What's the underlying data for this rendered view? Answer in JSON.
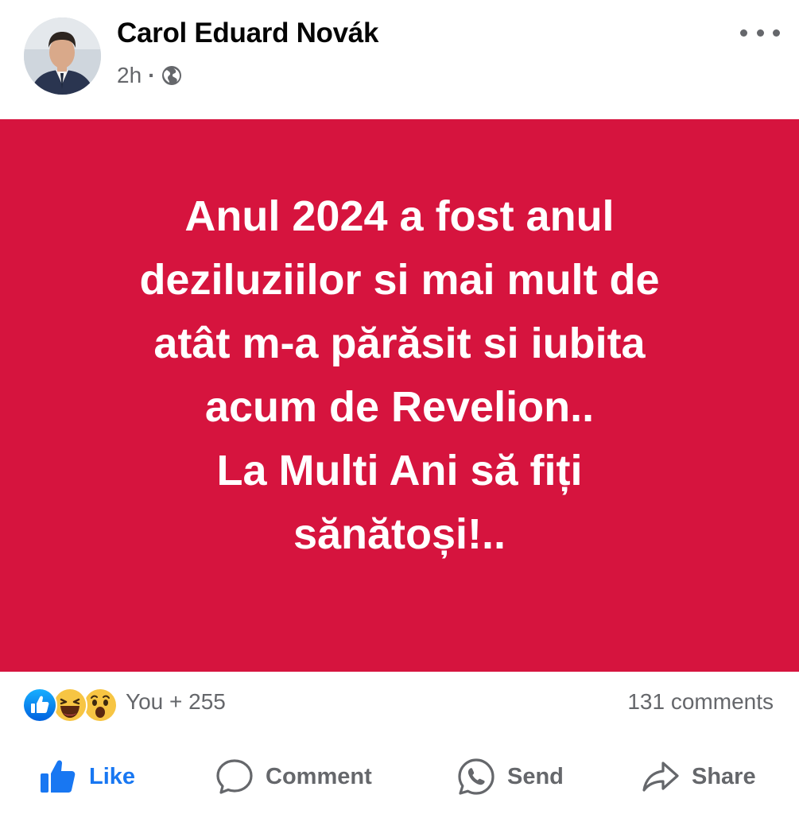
{
  "post": {
    "author_name": "Carol Eduard Novák",
    "timestamp": "2h",
    "separator": "·",
    "audience_icon": "globe-icon",
    "menu_icon": "more-horizontal-icon",
    "background_color": "#d6143e",
    "text_lines": [
      "Anul 2024 a fost anul",
      "deziluziilor si mai mult de",
      "atât m-a părăsit si iubita",
      "acum de Revelion..",
      "La Multi Ani să fiți",
      "sănătoși!.."
    ]
  },
  "reactions": {
    "icons": [
      "like-reaction-icon",
      "haha-reaction-icon",
      "wow-reaction-icon"
    ],
    "summary": "You + 255",
    "comments": "131 comments"
  },
  "actions": {
    "like": "Like",
    "comment": "Comment",
    "send": "Send",
    "share": "Share",
    "like_color": "#1877f2",
    "icon_color": "#65676b"
  }
}
